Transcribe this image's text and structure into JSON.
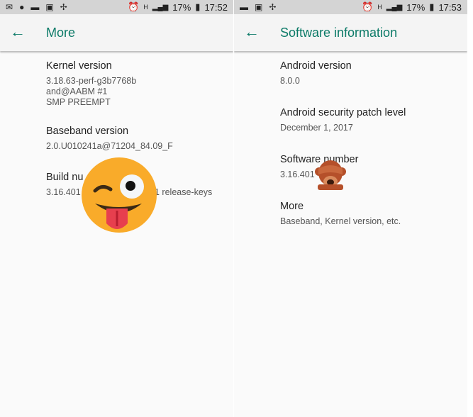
{
  "left": {
    "status": {
      "icons": [
        "mail-icon",
        "hangouts-icon",
        "message-icon",
        "gallery-mail-icon",
        "pinwheel-icon"
      ],
      "network": "H",
      "battery": "17%",
      "time": "17:52"
    },
    "title": "More",
    "items": [
      {
        "label": "Kernel version",
        "value": [
          "3.18.63-perf-g3b7768b",
          "and@AABM #1",
          "SMP PREEMPT"
        ]
      },
      {
        "label": "Baseband version",
        "value": [
          "2.0.U010241a@71204_84.09_F"
        ]
      },
      {
        "label": "Build nu",
        "value_start": "3.16.401",
        "value_end": "1 release-keys"
      }
    ],
    "overlay": "winking-tongue-emoji"
  },
  "right": {
    "status": {
      "icons": [
        "message-icon",
        "gallery-mail-icon",
        "pinwheel-icon"
      ],
      "network": "H",
      "battery": "17%",
      "time": "17:53"
    },
    "title": "Software information",
    "items": [
      {
        "label": "Android version",
        "value": "8.0.0"
      },
      {
        "label": "Android security patch level",
        "value": "December 1, 2017"
      },
      {
        "label": "Software number",
        "value": "3.16.401"
      },
      {
        "label": "More",
        "value": "Baseband, Kernel version, etc."
      }
    ],
    "overlay": "see-no-evil-monkey-emoji"
  },
  "colors": {
    "accent": "#0b7a67",
    "status_bar": "#d4d4d4"
  }
}
